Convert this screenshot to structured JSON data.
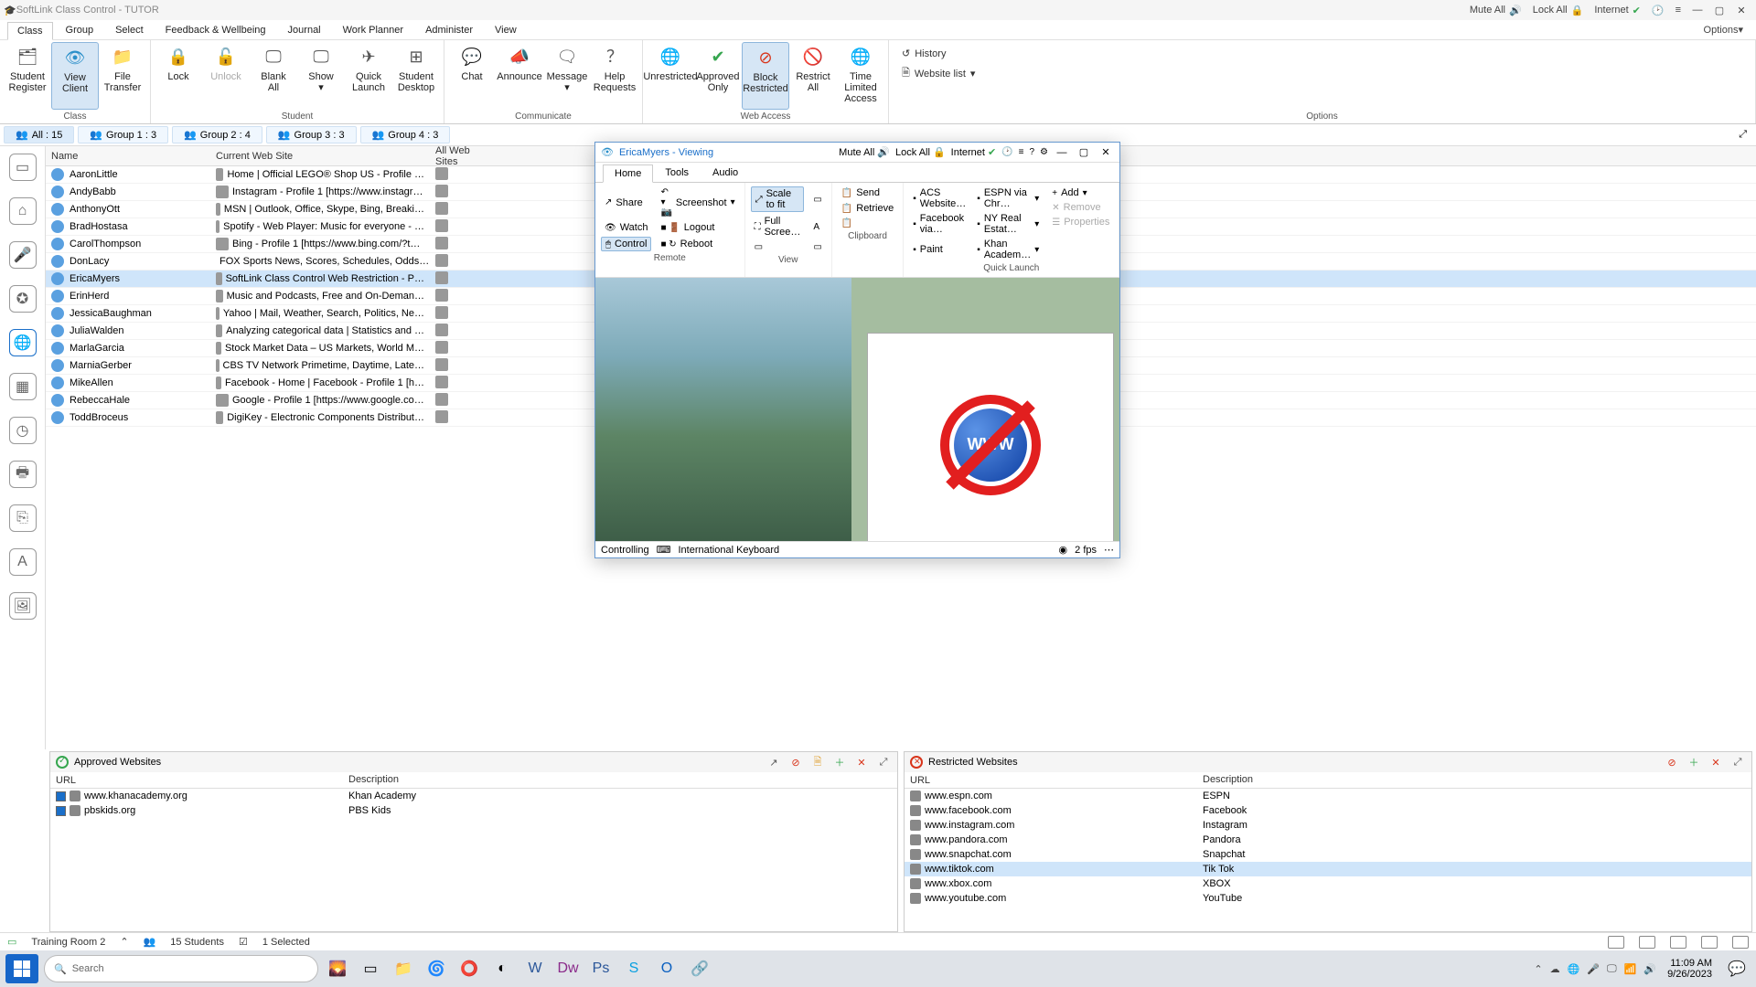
{
  "app": {
    "title": "SoftLink Class Control - TUTOR"
  },
  "titleActions": {
    "muteAll": "Mute All",
    "lockAll": "Lock All",
    "internet": "Internet"
  },
  "menu": {
    "tabs": [
      "Class",
      "Group",
      "Select",
      "Feedback & Wellbeing",
      "Journal",
      "Work Planner",
      "Administer",
      "View"
    ],
    "options": "Options"
  },
  "ribbon": {
    "groups": {
      "class": {
        "label": "Class",
        "buttons": [
          {
            "l1": "Student",
            "l2": "Register"
          },
          {
            "l1": "View",
            "l2": "Client"
          },
          {
            "l1": "File",
            "l2": "Transfer"
          }
        ]
      },
      "student": {
        "label": "Student",
        "buttons": [
          {
            "l1": "Lock"
          },
          {
            "l1": "Unlock"
          },
          {
            "l1": "Blank",
            "l2": "All"
          },
          {
            "l1": "Show",
            "l2": ""
          },
          {
            "l1": "Quick",
            "l2": "Launch"
          },
          {
            "l1": "Student",
            "l2": "Desktop"
          }
        ]
      },
      "communicate": {
        "label": "Communicate",
        "buttons": [
          {
            "l1": "Chat"
          },
          {
            "l1": "Announce"
          },
          {
            "l1": "Message",
            "l2": ""
          },
          {
            "l1": "Help",
            "l2": "Requests"
          }
        ]
      },
      "webaccess": {
        "label": "Web Access",
        "buttons": [
          {
            "l1": "Unrestricted"
          },
          {
            "l1": "Approved",
            "l2": "Only"
          },
          {
            "l1": "Block",
            "l2": "Restricted"
          },
          {
            "l1": "Restrict",
            "l2": "All"
          },
          {
            "l1": "Time Limited",
            "l2": "Access"
          }
        ]
      },
      "options": {
        "label": "Options",
        "history": "History",
        "websiteList": "Website list"
      }
    }
  },
  "groups": [
    {
      "label": "All : 15"
    },
    {
      "label": "Group 1 : 3"
    },
    {
      "label": "Group 2 : 4"
    },
    {
      "label": "Group 3 : 3"
    },
    {
      "label": "Group 4 : 3"
    }
  ],
  "columns": {
    "name": "Name",
    "current": "Current Web Site",
    "all": "All Web Sites"
  },
  "students": [
    {
      "name": "AaronLittle",
      "site": "Home | Official LEGO® Shop US - Profile …"
    },
    {
      "name": "AndyBabb",
      "site": "Instagram - Profile 1 [https://www.instagr…"
    },
    {
      "name": "AnthonyOtt",
      "site": "MSN | Outlook, Office, Skype, Bing, Breaki…"
    },
    {
      "name": "BradHostasa",
      "site": "Spotify - Web Player: Music for everyone - …"
    },
    {
      "name": "CarolThompson",
      "site": "Bing - Profile 1 [https://www.bing.com/?t…"
    },
    {
      "name": "DonLacy",
      "site": "FOX Sports News, Scores, Schedules, Odds…"
    },
    {
      "name": "EricaMyers",
      "site": "SoftLink Class Control Web Restriction - P…",
      "selected": true
    },
    {
      "name": "ErinHerd",
      "site": "Music and Podcasts, Free and On-Deman…"
    },
    {
      "name": "JessicaBaughman",
      "site": "Yahoo | Mail, Weather, Search, Politics, Ne…"
    },
    {
      "name": "JuliaWalden",
      "site": "Analyzing categorical data | Statistics and …"
    },
    {
      "name": "MarlaGarcia",
      "site": "Stock Market Data – US Markets, World M…"
    },
    {
      "name": "MarniaGerber",
      "site": "CBS TV Network Primetime, Daytime, Late…"
    },
    {
      "name": "MikeAllen",
      "site": "Facebook - Home | Facebook - Profile 1 [h…"
    },
    {
      "name": "RebeccaHale",
      "site": "Google - Profile 1 [https://www.google.co…"
    },
    {
      "name": "ToddBroceus",
      "site": "DigiKey - Electronic Components Distribut…"
    }
  ],
  "viewer": {
    "title": "EricaMyers - Viewing",
    "muteAll": "Mute All",
    "lockAll": "Lock All",
    "internet": "Internet",
    "tabs": [
      "Home",
      "Tools",
      "Audio"
    ],
    "remote": {
      "label": "Remote",
      "share": "Share",
      "watch": "Watch",
      "control": "Control",
      "screenshot": "Screenshot",
      "logout": "Logout",
      "reboot": "Reboot"
    },
    "view": {
      "label": "View",
      "scale": "Scale to fit",
      "full": "Full Scree…"
    },
    "clipboard": {
      "label": "Clipboard",
      "send": "Send",
      "retrieve": "Retrieve"
    },
    "ql": {
      "label": "Quick Launch",
      "items": [
        "ACS Website…",
        "ESPN via Chr…",
        "Facebook via…",
        "NY Real Estat…",
        "Paint",
        "Khan Academ…"
      ],
      "add": "Add",
      "remove": "Remove",
      "properties": "Properties"
    },
    "status": {
      "controlling": "Controlling",
      "keyboard": "International Keyboard",
      "fps": "2 fps"
    },
    "blockedGlobe": "WWW"
  },
  "approved": {
    "title": "Approved Websites",
    "cols": {
      "url": "URL",
      "desc": "Description"
    },
    "rows": [
      {
        "url": "www.khanacademy.org",
        "desc": "Khan Academy"
      },
      {
        "url": "pbskids.org",
        "desc": "PBS Kids"
      }
    ]
  },
  "restricted": {
    "title": "Restricted Websites",
    "cols": {
      "url": "URL",
      "desc": "Description"
    },
    "rows": [
      {
        "url": "www.espn.com",
        "desc": "ESPN"
      },
      {
        "url": "www.facebook.com",
        "desc": "Facebook"
      },
      {
        "url": "www.instagram.com",
        "desc": "Instagram"
      },
      {
        "url": "www.pandora.com",
        "desc": "Pandora"
      },
      {
        "url": "www.snapchat.com",
        "desc": "Snapchat"
      },
      {
        "url": "www.tiktok.com",
        "desc": "Tik Tok",
        "selected": true
      },
      {
        "url": "www.xbox.com",
        "desc": "XBOX"
      },
      {
        "url": "www.youtube.com",
        "desc": "YouTube"
      }
    ]
  },
  "status": {
    "room": "Training Room 2",
    "students": "15 Students",
    "selected": "1 Selected"
  },
  "taskbar": {
    "search": "Search",
    "time": "11:09 AM",
    "date": "9/26/2023"
  }
}
